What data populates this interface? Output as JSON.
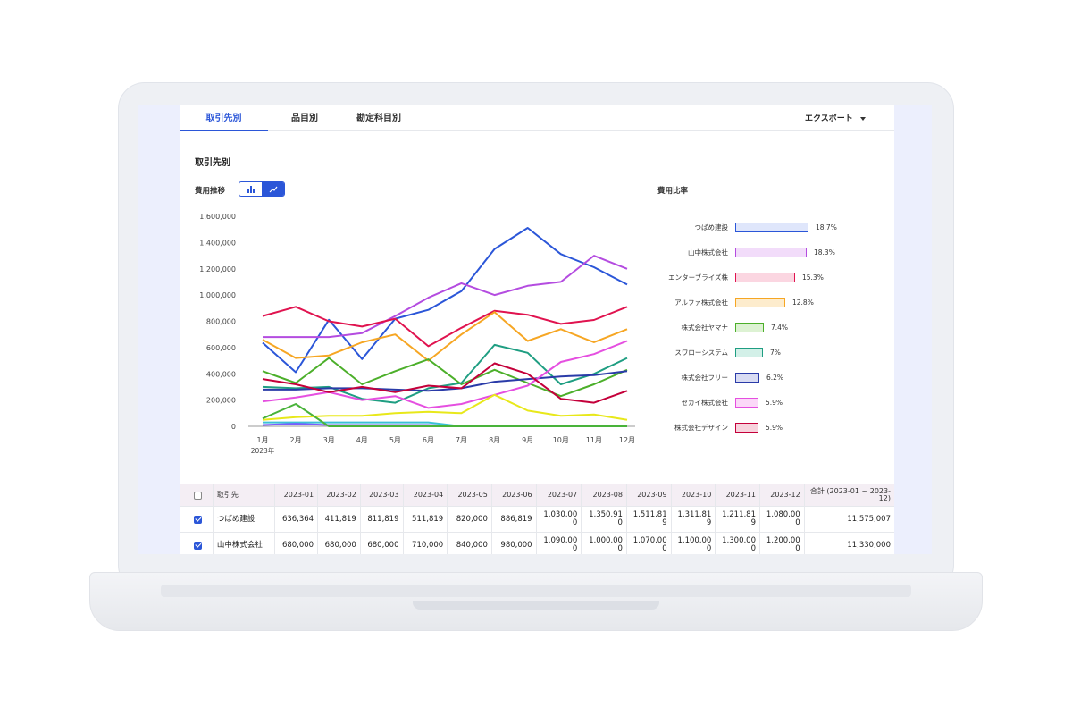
{
  "tabs": [
    {
      "label": "取引先別",
      "active": true
    },
    {
      "label": "品目別",
      "active": false
    },
    {
      "label": "勘定科目別",
      "active": false
    }
  ],
  "export_label": "エクスポート",
  "section_title": "取引先別",
  "trend_label": "費用推移",
  "view_toggle": {
    "options": [
      "bar-chart-icon",
      "line-chart-icon"
    ],
    "selected": "line-chart-icon"
  },
  "ratio_label": "費用比率",
  "colors": {
    "accent": "#2b56d8",
    "tab_active": "#2b56d8",
    "table_header_bg": "#f4eef4"
  },
  "chart_data": {
    "type": "line",
    "x": [
      "1月",
      "2月",
      "3月",
      "4月",
      "5月",
      "6月",
      "7月",
      "8月",
      "9月",
      "10月",
      "11月",
      "12月"
    ],
    "x_sublabel": "2023年",
    "ylim": [
      0,
      1600000
    ],
    "yticks": [
      "0",
      "200,000",
      "400,000",
      "600,000",
      "800,000",
      "1,000,000",
      "1,200,000",
      "1,400,000",
      "1,600,000"
    ],
    "grid": false,
    "series": [
      {
        "name": "つばめ建設",
        "color": "#2b56d8",
        "values": [
          636364,
          411819,
          811819,
          511819,
          820000,
          886819,
          1030000,
          1350910,
          1511819,
          1311819,
          1211819,
          1080000
        ]
      },
      {
        "name": "山中株式会社",
        "color": "#b44ce0",
        "values": [
          680000,
          680000,
          680000,
          710000,
          840000,
          980000,
          1090000,
          1000000,
          1070000,
          1100000,
          1300000,
          1200000
        ]
      },
      {
        "name": "エンターブライズ株",
        "color": "#e0134f",
        "values": [
          840000,
          910000,
          800000,
          760000,
          820000,
          610000,
          750000,
          880000,
          850000,
          780000,
          810000,
          910000
        ]
      },
      {
        "name": "アルファ株式会社",
        "color": "#f6a623",
        "values": [
          660000,
          520000,
          540000,
          640000,
          700000,
          500000,
          700000,
          870000,
          650000,
          740000,
          640000,
          740000
        ]
      },
      {
        "name": "株式会社ヤマナ",
        "color": "#4caf2a",
        "values": [
          420000,
          330000,
          520000,
          320000,
          420000,
          510000,
          320000,
          430000,
          330000,
          230000,
          320000,
          430000
        ]
      },
      {
        "name": "スワローシステム",
        "color": "#1f9e82",
        "values": [
          300000,
          290000,
          300000,
          210000,
          180000,
          290000,
          330000,
          620000,
          560000,
          320000,
          400000,
          520000
        ]
      },
      {
        "name": "株式会社フリー",
        "color": "#2a3ba8",
        "values": [
          280000,
          280000,
          290000,
          290000,
          280000,
          270000,
          290000,
          340000,
          360000,
          380000,
          390000,
          420000
        ]
      },
      {
        "name": "セカイ株式会社",
        "color": "#e54fe0",
        "values": [
          190000,
          220000,
          260000,
          200000,
          230000,
          140000,
          170000,
          240000,
          310000,
          490000,
          550000,
          650000
        ]
      },
      {
        "name": "株式会社デザイン",
        "color": "#c4003a",
        "values": [
          360000,
          320000,
          260000,
          300000,
          260000,
          310000,
          290000,
          480000,
          400000,
          210000,
          180000,
          270000
        ]
      },
      {
        "name": "",
        "color": "#e8e81a",
        "values": [
          50000,
          70000,
          80000,
          80000,
          100000,
          110000,
          100000,
          240000,
          120000,
          80000,
          90000,
          50000
        ]
      },
      {
        "name": "",
        "color": "#3cc0d8",
        "values": [
          30000,
          30000,
          30000,
          30000,
          30000,
          30000,
          0,
          0,
          0,
          0,
          0,
          0
        ]
      },
      {
        "name": "",
        "color": "#7b5cff",
        "values": [
          10000,
          20000,
          10000,
          10000,
          10000,
          10000,
          0,
          0,
          0,
          0,
          0,
          0
        ]
      },
      {
        "name": "",
        "color": "#49b33a",
        "values": [
          60000,
          170000,
          0,
          0,
          0,
          0,
          0,
          0,
          0,
          0,
          0,
          0
        ]
      }
    ]
  },
  "ratio_chart": {
    "type": "bar",
    "items": [
      {
        "name": "つばめ建設",
        "pct": "18.7%",
        "value": 18.7,
        "stroke": "#2b56d8",
        "fill": "#dfe6fb"
      },
      {
        "name": "山中株式会社",
        "pct": "18.3%",
        "value": 18.3,
        "stroke": "#b44ce0",
        "fill": "#f2dcfa"
      },
      {
        "name": "エンターブライズ株",
        "pct": "15.3%",
        "value": 15.3,
        "stroke": "#e0134f",
        "fill": "#fbd6e1"
      },
      {
        "name": "アルファ株式会社",
        "pct": "12.8%",
        "value": 12.8,
        "stroke": "#f6a623",
        "fill": "#fdeccd"
      },
      {
        "name": "株式会社ヤマナ",
        "pct": "7.4%",
        "value": 7.4,
        "stroke": "#4caf2a",
        "fill": "#ddf2d3"
      },
      {
        "name": "スワローシステム",
        "pct": "7%",
        "value": 7.0,
        "stroke": "#1f9e82",
        "fill": "#d3f0e8"
      },
      {
        "name": "株式会社フリー",
        "pct": "6.2%",
        "value": 6.2,
        "stroke": "#2a3ba8",
        "fill": "#d9dcf3"
      },
      {
        "name": "セカイ株式会社",
        "pct": "5.9%",
        "value": 5.9,
        "stroke": "#e54fe0",
        "fill": "#fbd8f8"
      },
      {
        "name": "株式会社デザイン",
        "pct": "5.9%",
        "value": 5.9,
        "stroke": "#c4003a",
        "fill": "#f7d3dd"
      }
    ]
  },
  "table": {
    "headers": [
      "取引先",
      "2023-01",
      "2023-02",
      "2023-03",
      "2023-04",
      "2023-05",
      "2023-06",
      "2023-07",
      "2023-08",
      "2023-09",
      "2023-10",
      "2023-11",
      "2023-12",
      "合計 (2023-01 ~ 2023-12)"
    ],
    "rows": [
      {
        "checked": true,
        "cells": [
          "つばめ建設",
          "636,364",
          "411,819",
          "811,819",
          "511,819",
          "820,000",
          "886,819",
          "1,030,000",
          "1,350,910",
          "1,511,819",
          "1,311,819",
          "1,211,819",
          "1,080,000",
          "11,575,007"
        ]
      },
      {
        "checked": true,
        "cells": [
          "山中株式会社",
          "680,000",
          "680,000",
          "680,000",
          "710,000",
          "840,000",
          "980,000",
          "1,090,000",
          "1,000,000",
          "1,070,000",
          "1,100,000",
          "1,300,000",
          "1,200,000",
          "11,330,000"
        ]
      }
    ]
  }
}
